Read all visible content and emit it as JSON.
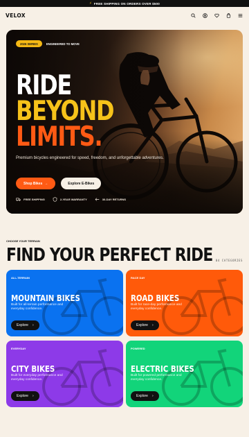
{
  "promo": {
    "text": "FREE SHIPPING ON ORDERS OVER $500"
  },
  "nav": {
    "logo": "VELOX"
  },
  "hero": {
    "badge": "2026 SERIES",
    "badge_caption": "ENGINEERED TO MOVE",
    "line1": "RIDE",
    "line2": "BEYOND",
    "line3": "LIMITS.",
    "subtitle": "Premium bicycles engineered for speed, freedom, and unforgettable adventures.",
    "cta_primary": "Shop Bikes",
    "cta_secondary": "Explore E-Bikes",
    "perks": [
      "FREE SHIPPING",
      "2-YEAR WARRANTY",
      "30-DAY RETURNS"
    ]
  },
  "terrain": {
    "eyebrow": "CHOOSE YOUR TERRAIN",
    "title": "FIND YOUR PERFECT RIDE",
    "count": "04 CATEGORIES"
  },
  "categories": [
    {
      "tag": "ALL-TERRAIN",
      "title": "MOUNTAIN BIKES",
      "desc": "Built for all-terrain performance and everyday confidence.",
      "button": "Explore",
      "color": "#0a72f0"
    },
    {
      "tag": "RACE DAY",
      "title": "ROAD BIKES",
      "desc": "Built for race-day performance and everyday confidence.",
      "button": "Explore",
      "color": "#ff5a0a"
    },
    {
      "tag": "EVERYDAY",
      "title": "CITY BIKES",
      "desc": "Built for everyday performance and everyday confidence.",
      "button": "Explore",
      "color": "#8d3ae8"
    },
    {
      "tag": "POWERED",
      "title": "ELECTRIC BIKES",
      "desc": "Built for powered performance and everyday confidence.",
      "button": "Explore",
      "color": "#12d47a"
    }
  ]
}
